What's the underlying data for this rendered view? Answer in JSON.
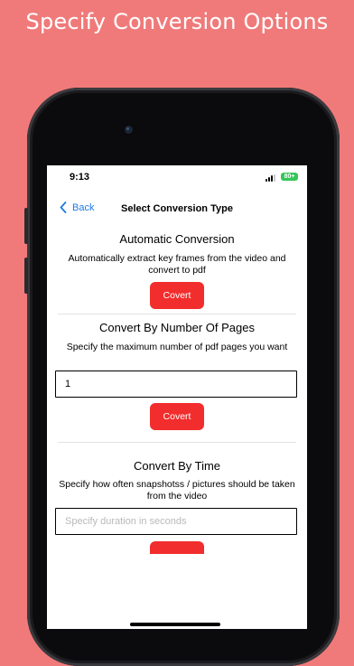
{
  "headline": "Specify Conversion Options",
  "status_bar": {
    "time": "9:13",
    "battery": "80+"
  },
  "nav": {
    "back_label": "Back",
    "title": "Select Conversion Type"
  },
  "sections": [
    {
      "title": "Automatic Conversion",
      "description": "Automatically extract key frames from the video and convert to pdf",
      "button_label": "Covert"
    },
    {
      "title": "Convert By Number Of Pages",
      "description": "Specify the maximum number of pdf pages you want",
      "input_value": "1",
      "button_label": "Covert"
    },
    {
      "title": "Convert By Time",
      "description": "Specify how often snapshotss / pictures should be taken from the video",
      "input_placeholder": "Specify duration in seconds"
    }
  ],
  "colors": {
    "background": "#f07a7a",
    "button": "#f22d2d",
    "link": "#1e7ae6",
    "battery": "#34c759"
  }
}
